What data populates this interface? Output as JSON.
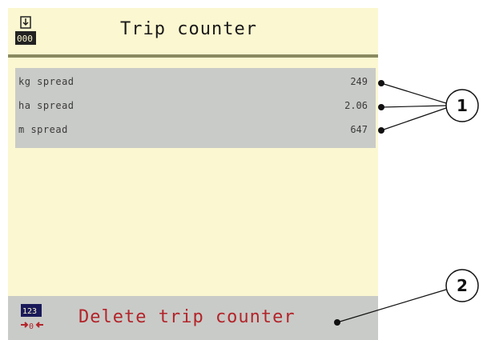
{
  "header": {
    "title": "Trip counter",
    "icon": "trip-counter-icon"
  },
  "counters": [
    {
      "label": "kg spread",
      "value": "249"
    },
    {
      "label": "ha spread",
      "value": "2.06"
    },
    {
      "label": "m spread",
      "value": "647"
    }
  ],
  "footer": {
    "label": "Delete trip counter",
    "icon": "delete-counter-icon"
  },
  "callouts": [
    {
      "number": "1"
    },
    {
      "number": "2"
    }
  ],
  "colors": {
    "background": "#fbf7d0",
    "list_background": "#c9cbc8",
    "delete_text": "#b3242a"
  }
}
